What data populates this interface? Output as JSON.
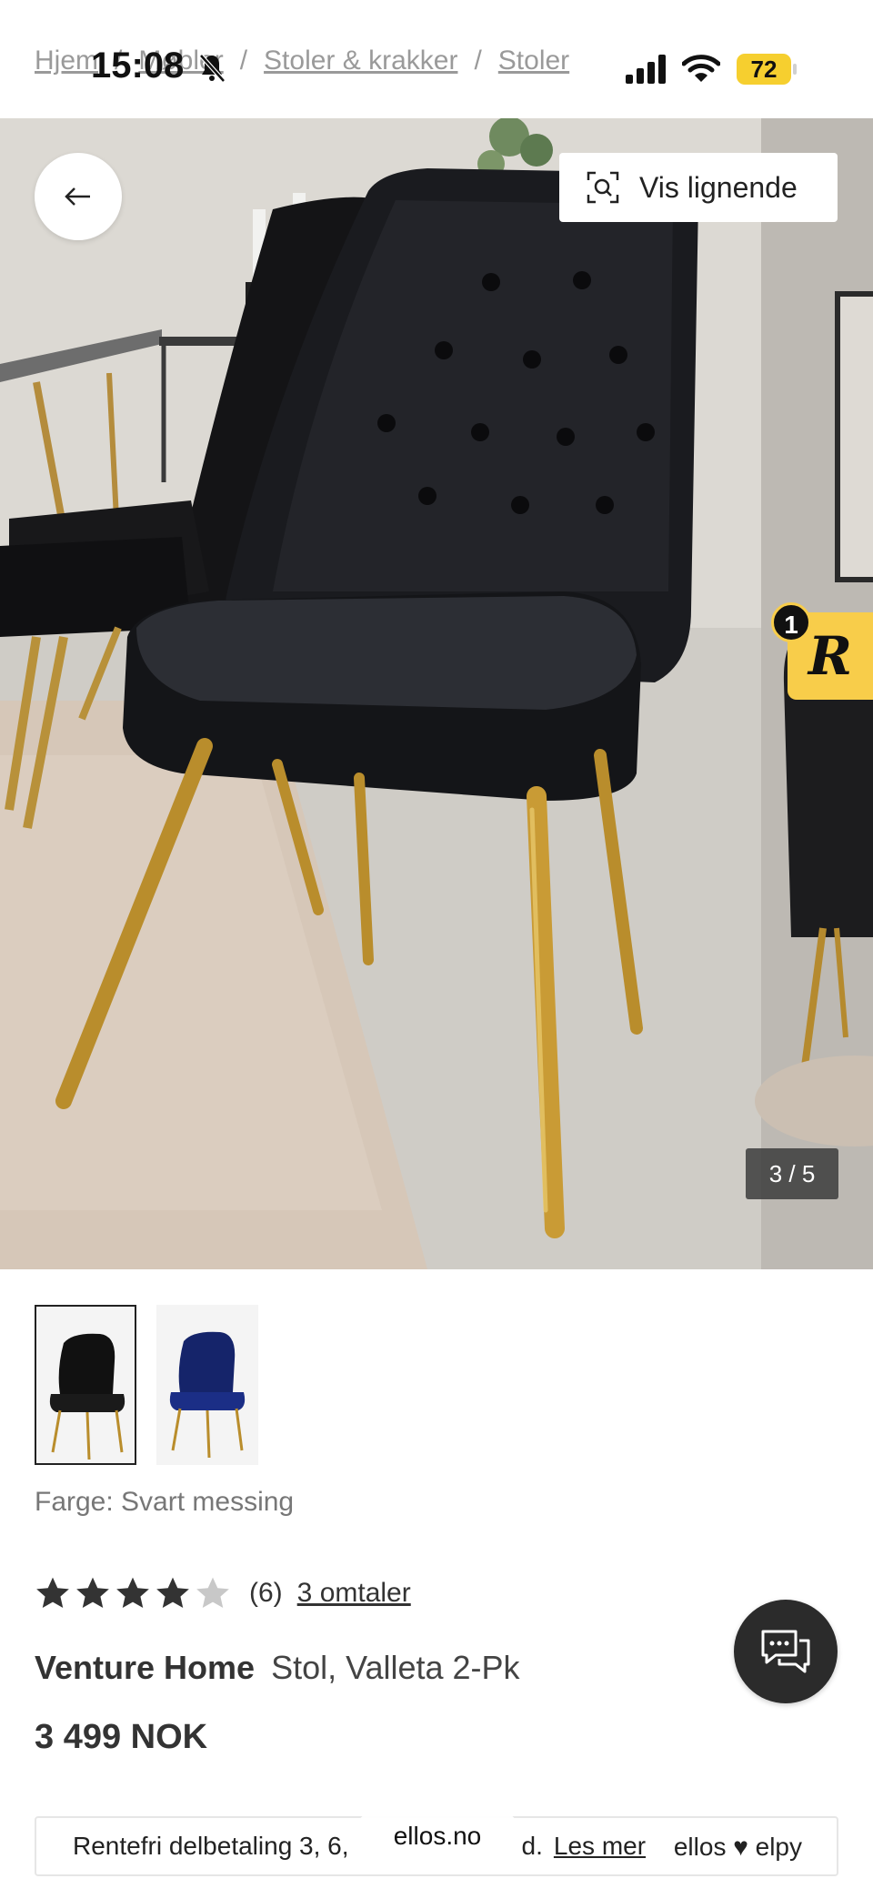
{
  "status_bar": {
    "time": "15:08",
    "battery": "72"
  },
  "breadcrumb": {
    "items": [
      "Hjem",
      "Møbler",
      "Stoler & krakker",
      "Stoler"
    ],
    "separator": "/"
  },
  "gallery": {
    "similar_label": "Vis lignende",
    "counter": "3 / 5",
    "badge_count": "1",
    "badge_letter": "R"
  },
  "product": {
    "color_label": "Farge: Svart messing",
    "rating": 4,
    "rating_count": "(6)",
    "reviews_label": "3 omtaler",
    "brand": "Venture Home",
    "name": "Stol, Valleta 2-Pk",
    "price": "3 499 NOK"
  },
  "installment": {
    "text": "Rentefri delbetaling 3, 6,",
    "text_end": "d.",
    "link": "Les mer",
    "logo": "ellos ♥ elpy"
  },
  "browser": {
    "url": "ellos.no"
  },
  "colors": {
    "accent_yellow": "#f8cd4a",
    "dark": "#2b2b2b",
    "battery": "#f6cf2f"
  },
  "icons": [
    "bell-muted-icon",
    "signal-icon",
    "wifi-icon",
    "back-arrow-icon",
    "visual-search-icon",
    "star-icon",
    "chat-icon"
  ]
}
